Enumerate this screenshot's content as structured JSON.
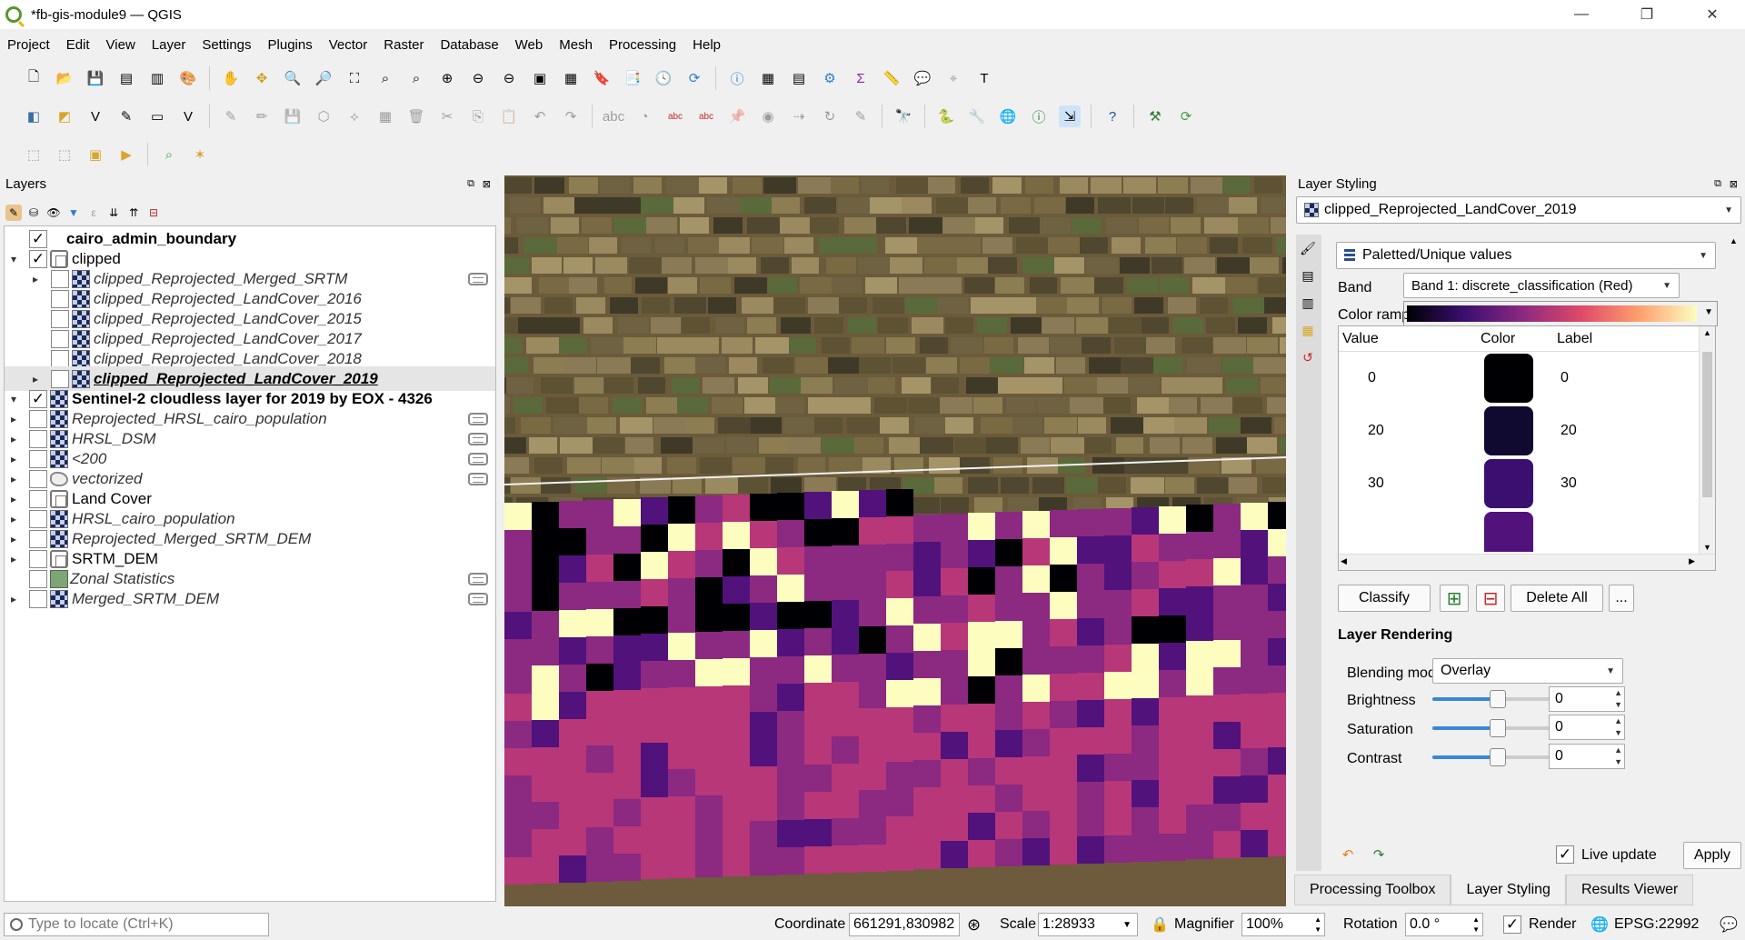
{
  "window": {
    "title": "*fb-gis-module9 — QGIS",
    "minimize": "—",
    "restore": "❐",
    "close": "✕"
  },
  "menu": [
    "Project",
    "Edit",
    "View",
    "Layer",
    "Settings",
    "Plugins",
    "Vector",
    "Raster",
    "Database",
    "Web",
    "Mesh",
    "Processing",
    "Help"
  ],
  "layers_panel": {
    "title": "Layers",
    "items": [
      {
        "name": "cairo_admin_boundary",
        "checked": true
      },
      {
        "name": "clipped",
        "checked": true
      },
      {
        "name": "clipped_Reprojected_Merged_SRTM",
        "checked": false
      },
      {
        "name": "clipped_Reprojected_LandCover_2016",
        "checked": false
      },
      {
        "name": "clipped_Reprojected_LandCover_2015",
        "checked": false
      },
      {
        "name": "clipped_Reprojected_LandCover_2017",
        "checked": false
      },
      {
        "name": "clipped_Reprojected_LandCover_2018",
        "checked": false
      },
      {
        "name": "clipped_Reprojected_LandCover_2019",
        "checked": false
      },
      {
        "name": "Sentinel-2 cloudless layer for 2019 by EOX - 4326",
        "checked": true
      },
      {
        "name": "Reprojected_HRSL_cairo_population",
        "checked": false
      },
      {
        "name": "HRSL_DSM",
        "checked": false
      },
      {
        "name": "<200",
        "checked": false
      },
      {
        "name": "vectorized",
        "checked": false
      },
      {
        "name": "Land Cover",
        "checked": false
      },
      {
        "name": "HRSL_cairo_population",
        "checked": false
      },
      {
        "name": "Reprojected_Merged_SRTM_DEM",
        "checked": false
      },
      {
        "name": "SRTM_DEM",
        "checked": false
      },
      {
        "name": "Zonal Statistics",
        "checked": false
      },
      {
        "name": "Merged_SRTM_DEM",
        "checked": false
      }
    ]
  },
  "styling": {
    "title": "Layer Styling",
    "layer": "clipped_Reprojected_LandCover_2019",
    "renderer": "Paletted/Unique values",
    "band_label": "Band",
    "band": "Band 1: discrete_classification (Red)",
    "ramp_label": "Color ramp",
    "columns": [
      "Value",
      "Color",
      "Label"
    ],
    "classes": [
      {
        "value": "0",
        "color": "#000004",
        "label": "0"
      },
      {
        "value": "20",
        "color": "#110a30",
        "label": "20"
      },
      {
        "value": "30",
        "color": "#3b0f70",
        "label": "30"
      },
      {
        "value": "",
        "color": "#51127c",
        "label": ""
      }
    ],
    "classify": "Classify",
    "delete_all": "Delete All",
    "more": "...",
    "rendering_title": "Layer Rendering",
    "blending_label": "Blending mode",
    "blending": "Overlay",
    "brightness_label": "Brightness",
    "brightness": "0",
    "saturation_label": "Saturation",
    "saturation": "0",
    "contrast_label": "Contrast",
    "contrast": "0",
    "live_update": "Live update",
    "apply": "Apply"
  },
  "bottom_tabs": [
    "Processing Toolbox",
    "Layer Styling",
    "Results Viewer"
  ],
  "status": {
    "locate_placeholder": "Type to locate (Ctrl+K)",
    "coordinate_label": "Coordinate",
    "coordinate": "661291,830982",
    "scale_label": "Scale",
    "scale": "1:28933",
    "magnifier_label": "Magnifier",
    "magnifier": "100%",
    "rotation_label": "Rotation",
    "rotation": "0.0 °",
    "render": "Render",
    "crs": "EPSG:22992"
  },
  "colors": {
    "magma_dark": "#000004",
    "magma_purple": "#51127c",
    "magma_magenta": "#8c2981",
    "magma_pink": "#b73779",
    "magma_cream": "#fcfdbf"
  }
}
